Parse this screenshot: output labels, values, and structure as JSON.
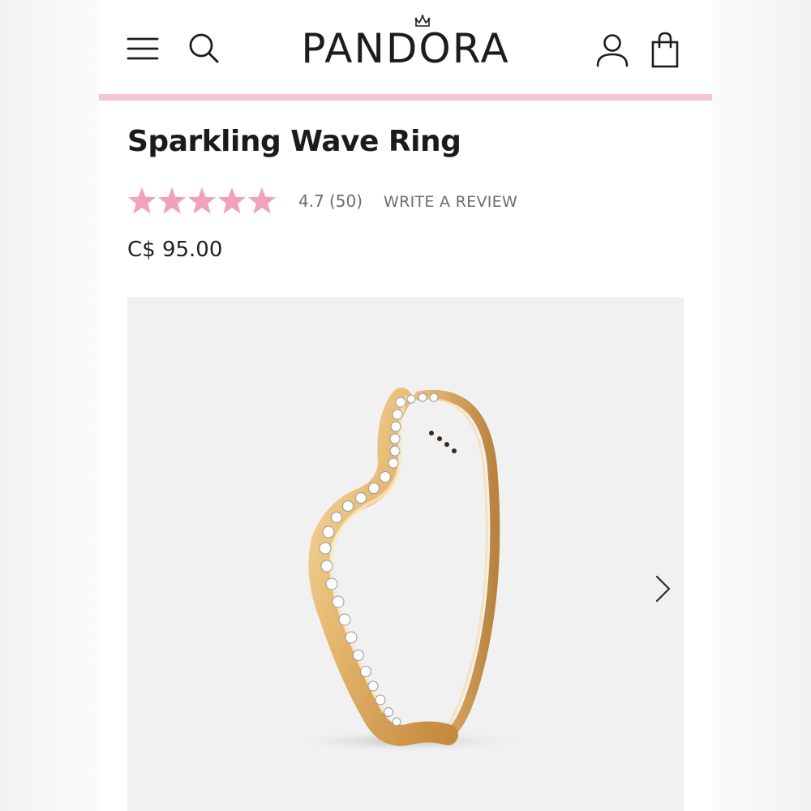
{
  "brand": {
    "logo_text": "PANDORA",
    "accent_color": "#f7c6d3",
    "star_color": "#f2a2b8"
  },
  "header": {
    "menu_icon": "hamburger-menu-icon",
    "search_icon": "search-icon",
    "account_icon": "account-icon",
    "bag_icon": "shopping-bag-icon"
  },
  "product": {
    "title": "Sparkling Wave Ring",
    "rating": "4.7",
    "review_count": "(50)",
    "rating_stars": 5,
    "write_review": "WRITE A REVIEW",
    "price": "C$ 95.00"
  },
  "gallery": {
    "next_icon": "chevron-right-icon"
  }
}
